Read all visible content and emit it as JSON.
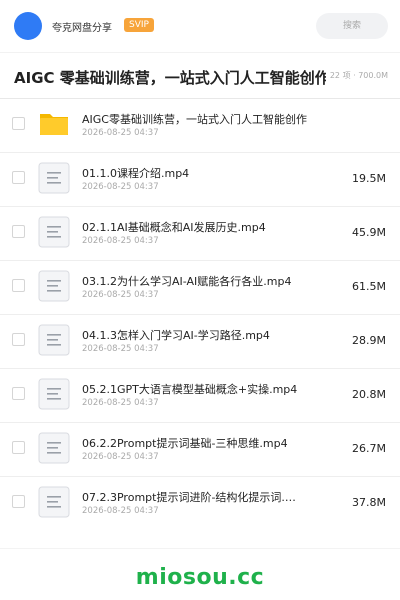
{
  "header": {
    "brand": "夸克网盘分享",
    "badge": "SVIP",
    "search_placeholder": "搜索"
  },
  "share": {
    "title": "AIGC 零基础训练营，一站式入门人工智能创作",
    "meta": "22 项 · 700.0M"
  },
  "files": [
    {
      "name": "AIGC零基础训练营，一站式入门人工智能创作",
      "date": "2026-08-25 04:37",
      "size": "",
      "icon": "folder-icon"
    },
    {
      "name": "01.1.0课程介绍.mp4",
      "date": "2026-08-25 04:37",
      "size": "19.5M",
      "icon": "file-icon"
    },
    {
      "name": "02.1.1AI基础概念和AI发展历史.mp4",
      "date": "2026-08-25 04:37",
      "size": "45.9M",
      "icon": "file-icon"
    },
    {
      "name": "03.1.2为什么学习AI-AI赋能各行各业.mp4",
      "date": "2026-08-25 04:37",
      "size": "61.5M",
      "icon": "file-icon"
    },
    {
      "name": "04.1.3怎样入门学习AI-学习路径.mp4",
      "date": "2026-08-25 04:37",
      "size": "28.9M",
      "icon": "file-icon"
    },
    {
      "name": "05.2.1GPT大语言模型基础概念+实操.mp4",
      "date": "2026-08-25 04:37",
      "size": "20.8M",
      "icon": "file-icon"
    },
    {
      "name": "06.2.2Prompt提示词基础-三种思维.mp4",
      "date": "2026-08-25 04:37",
      "size": "26.7M",
      "icon": "file-icon"
    },
    {
      "name": "07.2.3Prompt提示词进阶-结构化提示词.…",
      "date": "2026-08-25 04:37",
      "size": "37.8M",
      "icon": "file-icon"
    }
  ],
  "watermark": "miosou.cc",
  "colors": {
    "brand_blue": "#2f7bf5",
    "svip_orange": "#f7a43a",
    "folder_yellow": "#ffcb2b",
    "watermark_green": "#1fb14b"
  }
}
